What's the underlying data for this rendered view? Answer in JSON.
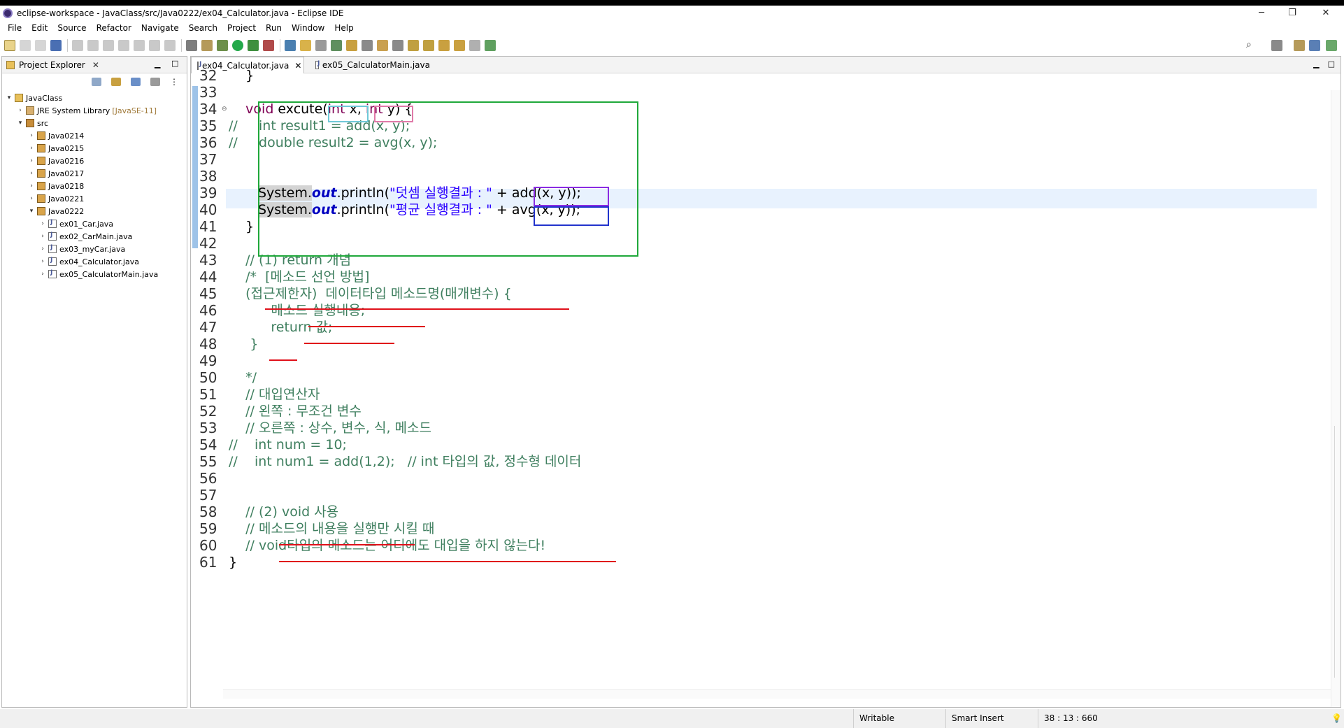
{
  "window": {
    "title": "eclipse-workspace - JavaClass/src/Java0222/ex04_Calculator.java - Eclipse IDE",
    "minimize": "─",
    "maximize": "❐",
    "close": "✕"
  },
  "menu": [
    "File",
    "Edit",
    "Source",
    "Refactor",
    "Navigate",
    "Search",
    "Project",
    "Run",
    "Window",
    "Help"
  ],
  "explorer": {
    "title": "Project Explorer",
    "close": "✕",
    "project": "JavaClass",
    "library": "JRE System Library",
    "library_version": "[JavaSE-11]",
    "src": "src",
    "packages": [
      "Java0214",
      "Java0215",
      "Java0216",
      "Java0217",
      "Java0218",
      "Java0221",
      "Java0222"
    ],
    "files": [
      "ex01_Car.java",
      "ex02_CarMain.java",
      "ex03_myCar.java",
      "ex04_Calculator.java",
      "ex05_CalculatorMain.java"
    ]
  },
  "editor": {
    "tabs": [
      {
        "label": "ex04_Calculator.java",
        "active": true,
        "close": "✕"
      },
      {
        "label": "ex05_CalculatorMain.java",
        "active": false
      }
    ],
    "line_numbers": [
      "32",
      "33",
      "34",
      "35",
      "36",
      "37",
      "38",
      "39",
      "40",
      "41",
      "42",
      "43",
      "44",
      "45",
      "46",
      "47",
      "48",
      "49",
      "50",
      "51",
      "52",
      "53",
      "54",
      "55",
      "56",
      "57",
      "58",
      "59",
      "60",
      "61"
    ],
    "lines": {
      "l32": "    }",
      "l34_a": "    ",
      "l34_void": "void",
      "l34_b": " excute(",
      "l34_int1": "int",
      "l34_c": " x, ",
      "l34_int2": "int",
      "l34_d": " y) {",
      "l35_cm": "//",
      "l35": "     int result1 = add(x, y);",
      "l36_cm": "//",
      "l36": "     double result2 = avg(x, y);",
      "l38_sys": "System.",
      "l38_out": "out",
      "l38_a": ".println(",
      "l38_str": "\"덧셈 실행결과 : \"",
      "l38_b": " + add(x, y));",
      "l39_sys": "System.",
      "l39_out": "out",
      "l39_a": ".println(",
      "l39_str": "\"평균 실행결과 : \"",
      "l39_b": " + avg(x, y));",
      "l40": "    }",
      "l42": "    // (1) return 개념",
      "l43": "    /*  [메소드 선언 방법]",
      "l44": "    (접근제한자)  데이터타입 메소드명(매개변수) {",
      "l45": "          메소드 실행내용;",
      "l46": "          return 값;",
      "l47": "     }",
      "l49": "    */",
      "l50": "    // 대입연산자",
      "l51": "    // 왼쪽 : 무조건 변수",
      "l52": "    // 오른쪽 : 상수, 변수, 식, 메소드",
      "l53_cm": "//",
      "l53": "    int num = 10;",
      "l54_cm": "//",
      "l54": "    int num1 = add(1,2);   // int 타입의 값, 정수형 데이터",
      "l57": "    // (2) void 사용",
      "l58": "    // 메소드의 내용을 실행만 시킬 때",
      "l59": "    // void타입의 메소드는 어디에도 대입을 하지 않는다!",
      "l60": "}"
    }
  },
  "status": {
    "writable": "Writable",
    "insert_mode": "Smart Insert",
    "position": "38 : 13 : 660"
  },
  "colors": {
    "keyword": "#7f0055",
    "comment": "#3f7f5f",
    "string": "#2a00ff",
    "annot_green": "#1fa83a",
    "annot_purple": "#8a2be2",
    "annot_blue": "#2233cc",
    "annot_red": "#e0101a"
  }
}
